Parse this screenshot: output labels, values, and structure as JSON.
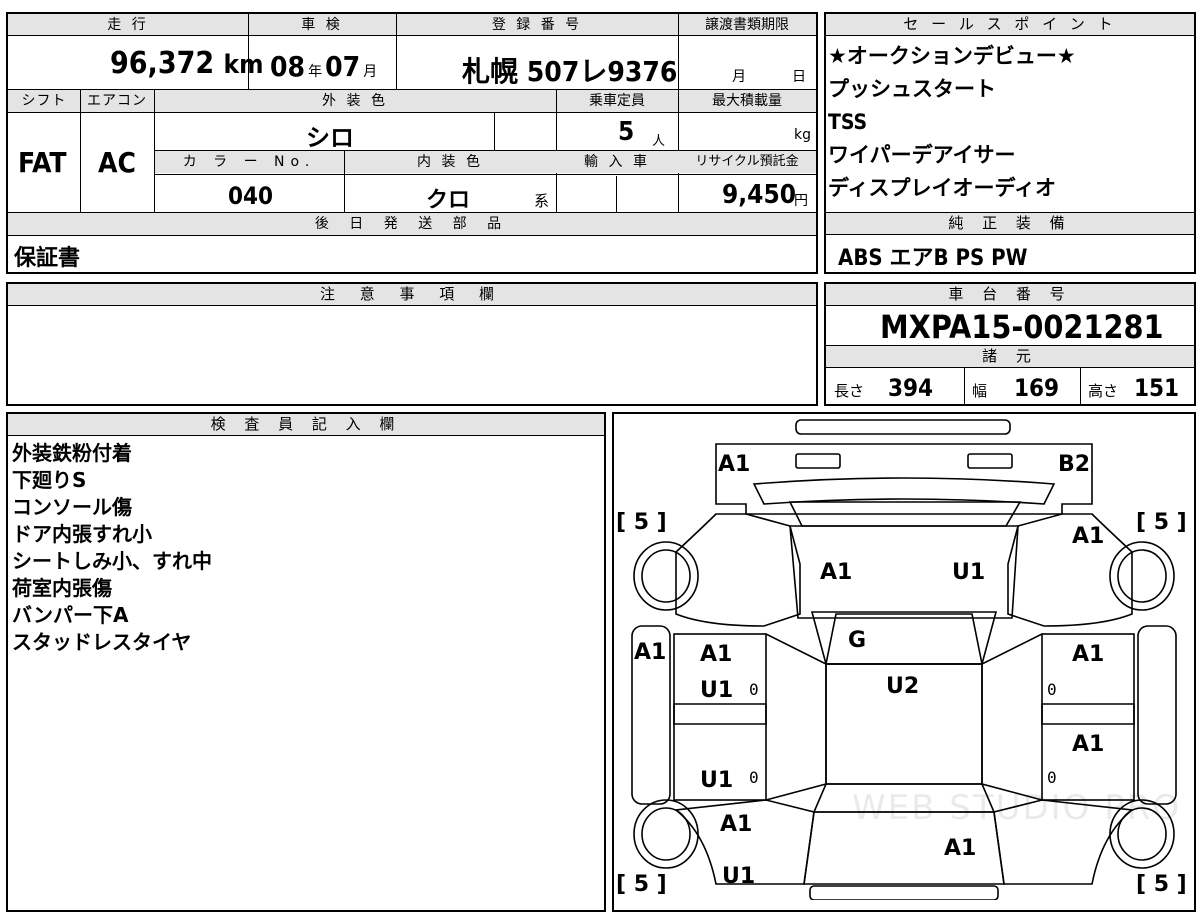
{
  "top": {
    "mileage_label": "走 行",
    "mileage": "96,372",
    "mileage_unit": "km",
    "inspection_label": "車 検",
    "insp_year": "08",
    "insp_year_unit": "年",
    "insp_month": "07",
    "insp_month_unit": "月",
    "reg_label": "登 録 番 号",
    "reg_number": "札幌 507レ9376",
    "transfer_label": "譲渡書類期限",
    "transfer_month_unit": "月",
    "transfer_day_unit": "日",
    "shift_label": "シフト",
    "shift": "FAT",
    "ac_label": "エアコン",
    "ac": "AC",
    "exterior_label": "外 装 色",
    "exterior": "シロ",
    "capacity_label": "乗車定員",
    "capacity": "5",
    "capacity_unit": "人",
    "maxload_label": "最大積載量",
    "maxload_unit": "kg",
    "color_no_label": "カ ラ ー No.",
    "color_no": "040",
    "interior_label": "内 装 色",
    "interior": "クロ",
    "interior_unit": "系",
    "import_label": "輸 入 車",
    "recycle_label": "リサイクル預託金",
    "recycle": "9,450",
    "recycle_unit": "円",
    "later_label": "後 日 発 送 部 品",
    "later": "保証書"
  },
  "sales": {
    "label": "セ ー ル ス ポ イ ン ト",
    "items": [
      "★オークションデビュー★",
      "プッシュスタート",
      "TSS",
      "ワイパーデアイサー",
      "ディスプレイオーディオ"
    ]
  },
  "equipment": {
    "label": "純 正 装 備",
    "items": "ABS エアB PS PW"
  },
  "caution": {
    "label": "注 意 事 項 欄"
  },
  "chassis": {
    "label": "車 台 番 号",
    "number": "MXPA15-0021281"
  },
  "specs": {
    "label": "諸 元",
    "length_label": "長さ",
    "length": "394",
    "width_label": "幅",
    "width": "169",
    "height_label": "高さ",
    "height": "151"
  },
  "inspector": {
    "label": "検 査 員 記 入 欄",
    "notes": [
      "外装鉄粉付着",
      "下廻りS",
      "コンソール傷",
      "ドア内張すれ小",
      "シートしみ小、すれ中",
      "荷室内張傷",
      "バンパー下A",
      "スタッドレスタイヤ"
    ]
  },
  "diagram": {
    "marks": [
      "A1",
      "B2",
      "A1",
      "A1",
      "U1",
      "G",
      "A1",
      "U2",
      "A1",
      "U1",
      "A1",
      "A1",
      "U1",
      "A1",
      "A1",
      "U1"
    ],
    "tires": [
      "[ 5 ]",
      "[ 5 ]",
      "[ 5 ]",
      "[ 5 ]"
    ],
    "zeros": [
      "0",
      "0",
      "0",
      "0"
    ],
    "watermark": "WEB STUDIO PRO"
  }
}
